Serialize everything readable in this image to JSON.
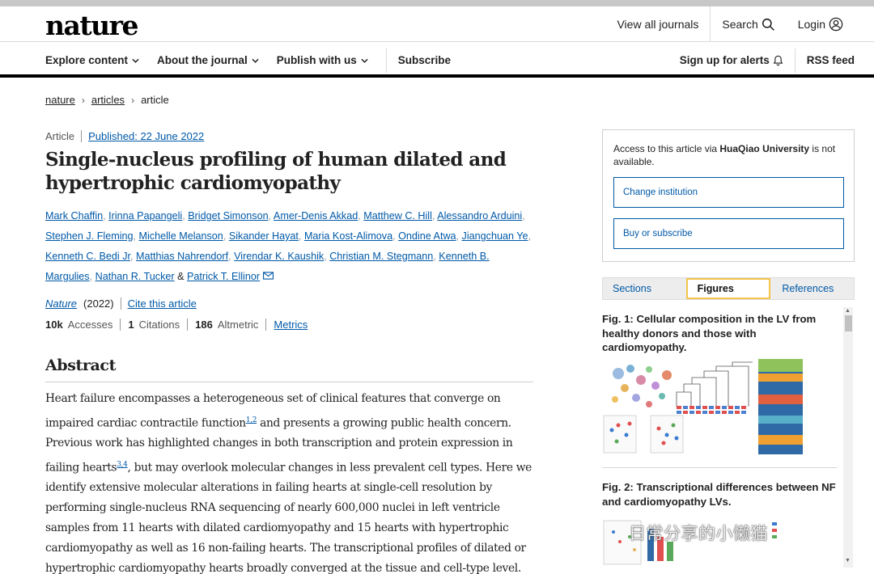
{
  "header": {
    "logo": "nature",
    "top_links": [
      "View all journals",
      "Search",
      "Login"
    ]
  },
  "nav": {
    "items": [
      "Explore content",
      "About the journal",
      "Publish with us"
    ],
    "subscribe": "Subscribe",
    "alerts": "Sign up for alerts",
    "rss": "RSS feed"
  },
  "breadcrumb": [
    "nature",
    "articles",
    "article"
  ],
  "article": {
    "type": "Article",
    "published": "Published: 22 June 2022",
    "title": "Single-nucleus profiling of human dilated and hypertrophic cardiomyopathy",
    "authors": [
      "Mark Chaffin",
      "Irinna Papangeli",
      "Bridget Simonson",
      "Amer-Denis Akkad",
      "Matthew C. Hill",
      "Alessandro Arduini",
      "Stephen J. Fleming",
      "Michelle Melanson",
      "Sikander Hayat",
      "Maria Kost-Alimova",
      "Ondine Atwa",
      "Jiangchuan Ye",
      "Kenneth C. Bedi Jr",
      "Matthias Nahrendorf",
      "Virendar K. Kaushik",
      "Christian M. Stegmann",
      "Kenneth B. Margulies",
      "Nathan R. Tucker",
      "Patrick T. Ellinor"
    ],
    "and_text": "&",
    "journal": "Nature",
    "year": "(2022)",
    "cite_label": "Cite this article",
    "metrics": {
      "accesses_value": "10k",
      "accesses_label": "Accesses",
      "citations_value": "1",
      "citations_label": "Citations",
      "altmetric_value": "186",
      "altmetric_label": "Altmetric",
      "metrics_link": "Metrics"
    }
  },
  "abstract": {
    "heading": "Abstract",
    "p1": "Heart failure encompasses a heterogeneous set of clinical features that converge on impaired cardiac contractile function",
    "ref1": "1,2",
    "p2": " and presents a growing public health concern. Previous work has highlighted changes in both transcription and protein expression in failing hearts",
    "ref2": "3,4",
    "p3": ", but may overlook molecular changes in less prevalent cell types. Here we identify extensive molecular alterations in failing hearts at single-cell resolution by performing single-nucleus RNA sequencing of nearly 600,000 nuclei in left ventricle samples from 11 hearts with dilated cardiomyopathy and 15 hearts with hypertrophic cardiomyopathy as well as 16 non-failing hearts. The transcriptional profiles of dilated or hypertrophic cardiomyopathy hearts broadly converged at the tissue and cell-type level. Further, a subset of hearts from patients with"
  },
  "sidebar": {
    "access_prefix": "Access to this article via ",
    "institution": "HuaQiao University",
    "access_suffix": " is not available.",
    "change_institution": "Change institution",
    "buy": "Buy or subscribe",
    "tabs": [
      "Sections",
      "Figures",
      "References"
    ],
    "active_tab": "Figures",
    "figures": [
      {
        "title": "Fig. 1: Cellular composition in the LV from healthy donors and those with cardiomyopathy."
      },
      {
        "title": "Fig. 2: Transcriptional differences between NF and cardiomyopathy LVs."
      }
    ]
  },
  "watermark": "日常分享的小懒猫",
  "colors": {
    "link": "#0059a8",
    "tab_highlight": "#f4c44c"
  }
}
